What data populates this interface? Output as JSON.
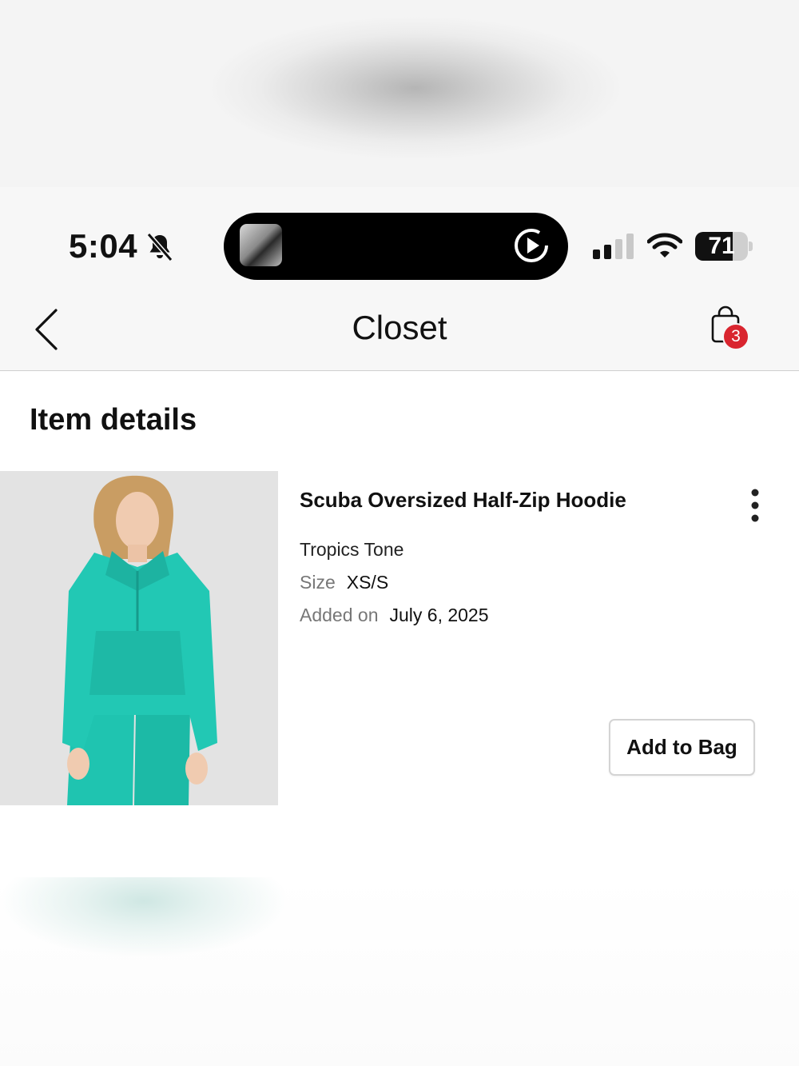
{
  "status_bar": {
    "time": "5:04",
    "battery_level": "71",
    "battery_percent": 71
  },
  "nav": {
    "title": "Closet",
    "bag_count": "3"
  },
  "section": {
    "title": "Item details"
  },
  "item": {
    "name": "Scuba Oversized Half-Zip Hoodie",
    "color": "Tropics Tone",
    "size_label": "Size",
    "size_value": "XS/S",
    "added_label": "Added on",
    "added_value": "July 6, 2025",
    "add_button_label": "Add to Bag",
    "garment_color": "#1fc4b0"
  },
  "icons": {
    "status": [
      "bell-slash-icon",
      "play-icon",
      "signal-icon",
      "wifi-icon",
      "battery-icon"
    ],
    "nav": [
      "chevron-left-icon",
      "shopping-bag-icon"
    ],
    "item": [
      "more-vertical-icon"
    ]
  }
}
